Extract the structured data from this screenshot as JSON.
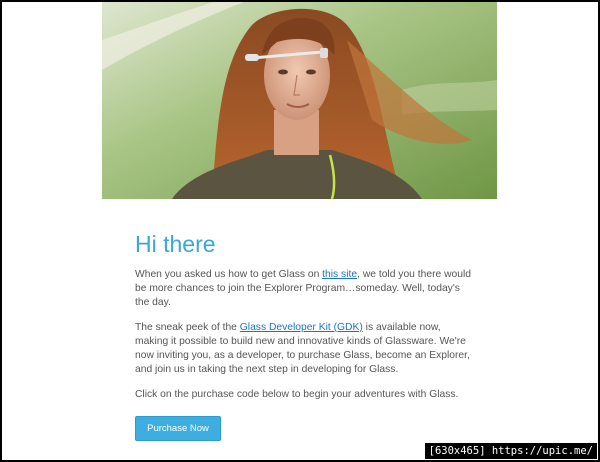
{
  "hero": {
    "alt": "Woman wearing Google Glass"
  },
  "email": {
    "greeting": "Hi there",
    "para1": {
      "before": "When you asked us how to get Glass on ",
      "link": "this site",
      "after": ", we told you there would be more chances to join the Explorer Program…someday. Well, today's the day."
    },
    "para2": {
      "before": "The sneak peek of the ",
      "link": "Glass Developer Kit (GDK)",
      "after": " is available now, making it possible to build new and innovative kinds of Glassware. We're now inviting you, as a developer, to purchase Glass, become an Explorer, and join us in taking the next step in developing for Glass."
    },
    "para3": "Click on the purchase code below to begin your adventures with Glass.",
    "button_label": "Purchase Now"
  },
  "watermark": "[630x465] https://upic.me/",
  "colors": {
    "accent": "#3aa7d6",
    "button": "#3eaee0",
    "link": "#1a73c9",
    "text": "#555555"
  }
}
